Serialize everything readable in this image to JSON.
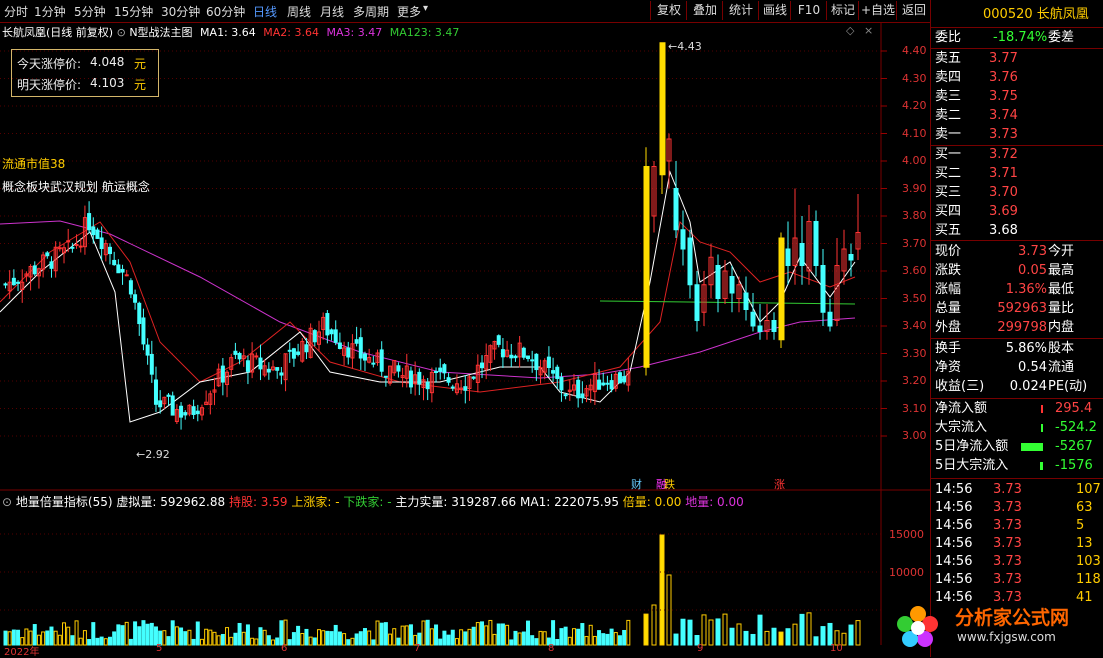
{
  "topbar": {
    "periods": [
      "分时",
      "1分钟",
      "5分钟",
      "15分钟",
      "30分钟",
      "60分钟",
      "日线",
      "周线",
      "月线",
      "多周期",
      "更多"
    ],
    "active_period": "日线",
    "buttons": [
      "复权",
      "叠加",
      "统计",
      "画线",
      "F10",
      "标记",
      "+自选",
      "返回"
    ]
  },
  "chart_header": {
    "stock_label": "长航凤凰(日线 前复权)",
    "main_indicator": "N型战法主图",
    "ma1": "MA1: 3.64",
    "ma2": "MA2: 3.64",
    "ma3": "MA3: 3.47",
    "ma123": "MA123: 3.47"
  },
  "limit_box": {
    "today_label": "今天涨停价:",
    "today_value": "4.048",
    "tomorrow_label": "明天涨停价:",
    "tomorrow_value": "4.103",
    "unit": "元"
  },
  "overlay": {
    "market_cap_label": "流通市值38",
    "concept": "概念板块武汉规划 航运概念"
  },
  "price_axis": [
    "4.40",
    "4.30",
    "4.20",
    "4.10",
    "4.00",
    "3.90",
    "3.80",
    "3.70",
    "3.60",
    "3.50",
    "3.40",
    "3.30",
    "3.20",
    "3.10",
    "3.00"
  ],
  "annotations": {
    "high": "4.43",
    "low": "2.92",
    "markers": [
      "财",
      "融",
      "跌",
      "涨"
    ]
  },
  "indicator": {
    "name": "地量倍量指标(55)",
    "virtual_vol": "虚拟量: 592962.88",
    "hold": "持股: 3.59",
    "up": "上涨家: -",
    "down": "下跌家: -",
    "main_vol": "主力实量: 319287.66",
    "ma1": "MA1: 222075.95",
    "bei": "倍量: 0.00",
    "di": "地量: 0.00",
    "axis": [
      "15000",
      "10000"
    ]
  },
  "date_axis": [
    "2022年",
    "5",
    "6",
    "7",
    "8",
    "9",
    "10"
  ],
  "quote": {
    "code": "000520",
    "name": "长航凤凰",
    "weibi_label": "委比",
    "weibi": "-18.74%",
    "weicha_label": "委差",
    "asks": [
      {
        "label": "卖五",
        "price": "3.77"
      },
      {
        "label": "卖四",
        "price": "3.76"
      },
      {
        "label": "卖三",
        "price": "3.75"
      },
      {
        "label": "卖二",
        "price": "3.74"
      },
      {
        "label": "卖一",
        "price": "3.73"
      }
    ],
    "bids": [
      {
        "label": "买一",
        "price": "3.72"
      },
      {
        "label": "买二",
        "price": "3.71"
      },
      {
        "label": "买三",
        "price": "3.70"
      },
      {
        "label": "买四",
        "price": "3.69"
      },
      {
        "label": "买五",
        "price": "3.68"
      }
    ],
    "stats": [
      {
        "l": "现价",
        "v": "3.73",
        "r": "今开"
      },
      {
        "l": "涨跌",
        "v": "0.05",
        "r": "最高"
      },
      {
        "l": "涨幅",
        "v": "1.36%",
        "r": "最低"
      },
      {
        "l": "总量",
        "v": "592963",
        "r": "量比"
      },
      {
        "l": "外盘",
        "v": "299798",
        "r": "内盘"
      }
    ],
    "stats2": [
      {
        "l": "换手",
        "v": "5.86%",
        "r": "股本"
      },
      {
        "l": "净资",
        "v": "0.54",
        "r": "流通"
      },
      {
        "l": "收益(三)",
        "v": "0.024",
        "r": "PE(动)"
      }
    ],
    "flows": [
      {
        "l": "净流入额",
        "v": "295.4"
      },
      {
        "l": "大宗流入",
        "v": "-524.2"
      },
      {
        "l": "5日净流入额",
        "v": "-5267"
      },
      {
        "l": "5日大宗流入",
        "v": "-1576"
      }
    ],
    "ticks": [
      {
        "t": "14:56",
        "p": "3.73",
        "v": "107"
      },
      {
        "t": "14:56",
        "p": "3.73",
        "v": "63"
      },
      {
        "t": "14:56",
        "p": "3.73",
        "v": "5"
      },
      {
        "t": "14:56",
        "p": "3.73",
        "v": "13"
      },
      {
        "t": "14:56",
        "p": "3.73",
        "v": "103"
      },
      {
        "t": "14:56",
        "p": "3.73",
        "v": "118"
      },
      {
        "t": "14:56",
        "p": "3.73",
        "v": "41"
      }
    ]
  },
  "watermark": {
    "brand": "分析家公式网",
    "url": "www.fxjgsw.com"
  },
  "colors": {
    "up": "#ff3333",
    "down": "#44ffff",
    "limit": "#ffdd00",
    "ma_white": "#ffffff",
    "ma_red": "#dd2222",
    "ma_purple": "#cc33cc",
    "ma_green": "#33cc33"
  }
}
